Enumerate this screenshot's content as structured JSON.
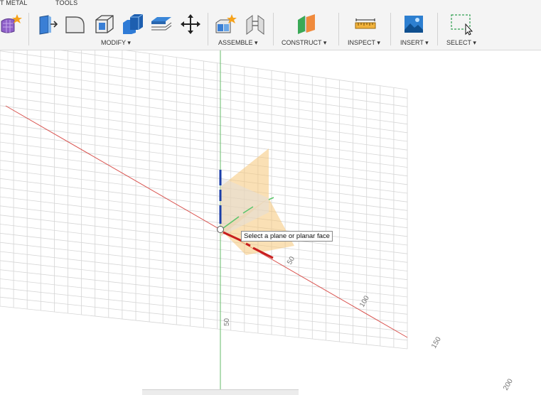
{
  "tabs": {
    "sheet_metal": "T METAL",
    "tools": "TOOLS"
  },
  "groups": {
    "modify": "MODIFY ▾",
    "assemble": "ASSEMBLE ▾",
    "construct": "CONSTRUCT ▾",
    "inspect": "INSPECT ▾",
    "insert": "INSERT ▾",
    "select": "SELECT ▾"
  },
  "icons": {
    "create_form": "create-form-icon",
    "press_pull": "press-pull-icon",
    "fillet": "fillet-icon",
    "shell": "shell-icon",
    "combine": "combine-icon",
    "offset_face": "offset-face-icon",
    "move": "move-icon",
    "new_component": "new-component-icon",
    "joint": "joint-icon",
    "construct_plane": "construct-plane-icon",
    "measure": "measure-icon",
    "insert_image": "insert-image-icon",
    "select": "select-icon"
  },
  "viewport": {
    "tooltip": "Select a plane or planar face",
    "axis_ticks": [
      "50",
      "100",
      "150",
      "200",
      "50"
    ]
  },
  "colors": {
    "x_axis": "#d9534f",
    "y_axis": "#66bb6a",
    "z_axis": "#1a3ea8",
    "plane": "#f5c679",
    "grid": "#d6d6d6"
  }
}
